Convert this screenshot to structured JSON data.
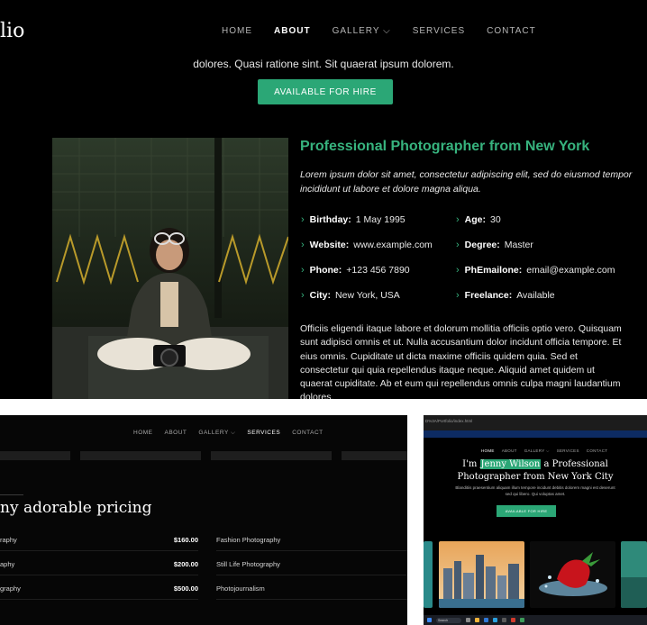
{
  "panel1": {
    "logo": "lio",
    "nav": [
      {
        "label": "HOME",
        "active": false
      },
      {
        "label": "ABOUT",
        "active": true
      },
      {
        "label": "GALLERY",
        "active": false,
        "dropdown": true
      },
      {
        "label": "SERVICES",
        "active": false
      },
      {
        "label": "CONTACT",
        "active": false
      }
    ],
    "intro": "dolores. Quasi ratione sint. Sit quaerat ipsum dolorem.",
    "hire_button": "AVAILABLE FOR HIRE",
    "heading": "Professional Photographer from New York",
    "lede": "Lorem ipsum dolor sit amet, consectetur adipiscing elit, sed do eiusmod tempor incididunt ut labore et dolore magna aliqua.",
    "facts": [
      {
        "label": "Birthday:",
        "value": "1 May 1995"
      },
      {
        "label": "Age:",
        "value": "30"
      },
      {
        "label": "Website:",
        "value": "www.example.com"
      },
      {
        "label": "Degree:",
        "value": "Master"
      },
      {
        "label": "Phone:",
        "value": "+123 456 7890"
      },
      {
        "label": "PhEmailone:",
        "value": "email@example.com"
      },
      {
        "label": "City:",
        "value": "New York, USA"
      },
      {
        "label": "Freelance:",
        "value": "Available"
      }
    ],
    "body": "Officiis eligendi itaque labore et dolorum mollitia officiis optio vero. Quisquam sunt adipisci omnis et ut. Nulla accusantium dolor incidunt officia tempore. Et eius omnis. Cupiditate ut dicta maxime officiis quidem quia. Sed et consectetur qui quia repellendus itaque neque. Aliquid amet quidem ut quaerat cupiditate. Ab et eum qui repellendus omnis culpa magni laudantium dolores.",
    "accent": "#37b37e"
  },
  "panel2": {
    "nav": [
      {
        "label": "HOME",
        "active": false
      },
      {
        "label": "ABOUT",
        "active": false
      },
      {
        "label": "GALLERY",
        "active": false,
        "dropdown": true
      },
      {
        "label": "SERVICES",
        "active": true
      },
      {
        "label": "CONTACT",
        "active": false
      }
    ],
    "title": "ny adorable pricing",
    "left_rows": [
      {
        "name": "raphy",
        "price": "$160.00"
      },
      {
        "name": "aphy",
        "price": "$200.00"
      },
      {
        "name": "graphy",
        "price": "$500.00"
      }
    ],
    "right_rows": [
      {
        "name": "Fashion Photography"
      },
      {
        "name": "Still Life Photography"
      },
      {
        "name": "Photojournalism"
      }
    ]
  },
  "panel3": {
    "url": "D%3A/Portfolio/index.html",
    "nav": [
      {
        "label": "HOME",
        "active": true
      },
      {
        "label": "ABOUT",
        "active": false
      },
      {
        "label": "GALLERY",
        "active": false,
        "dropdown": true
      },
      {
        "label": "SERVICES",
        "active": false
      },
      {
        "label": "CONTACT",
        "active": false
      }
    ],
    "h1_pre": "I'm ",
    "h1_name": "Jenny Wilson",
    "h1_post": " a Professional",
    "h1_line2": "Photographer from New York City",
    "subtitle": "Blanditiis praesentium aliquam illum tempore incidunt debitis dolorem magni est deserunt sed qui libero. Qui voluptas amet.",
    "hire_button": "AVAILABLE FOR HIRE",
    "taskbar_search": "Search"
  }
}
